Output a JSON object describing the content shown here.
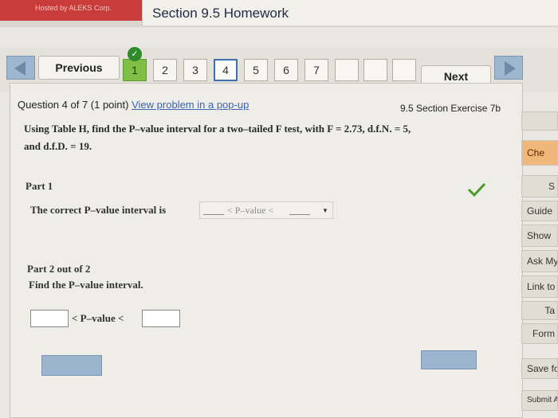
{
  "header": {
    "hosted_by": "Hosted by ALEKS Corp.",
    "title": "Section 9.5 Homework"
  },
  "nav": {
    "previous_label": "Previous",
    "next_label": "Next",
    "questions": [
      "1",
      "2",
      "3",
      "4",
      "5",
      "6",
      "7"
    ],
    "current": "4",
    "completed": [
      "1"
    ]
  },
  "question": {
    "info": "Question 4 of 7 (1 point)",
    "popup_link": "View problem in a pop-up",
    "exercise": "9.5 Section Exercise 7b",
    "prompt_line1": "Using Table H, find the P–value interval for a two–tailed F test, with F = 2.73, d.f.N. = 5,",
    "prompt_line2": "and d.f.D. = 19."
  },
  "part1": {
    "title": "Part 1",
    "text": "The correct P–value interval is",
    "select_text": "< P–value <"
  },
  "part2": {
    "title": "Part 2 out of 2",
    "text": "Find the P–value interval.",
    "inequality_label": "< P–value <"
  },
  "sidebar": {
    "items": [
      "Che",
      "S",
      "Guide",
      "Show",
      "Ask My",
      "Link to",
      "Ta",
      "Form",
      "Save fo",
      "Submit As"
    ]
  },
  "colors": {
    "accent_green": "#7fbf46",
    "header_red": "#c83c3a",
    "button_blue": "#9db4cf",
    "side_orange": "#efb87a"
  }
}
